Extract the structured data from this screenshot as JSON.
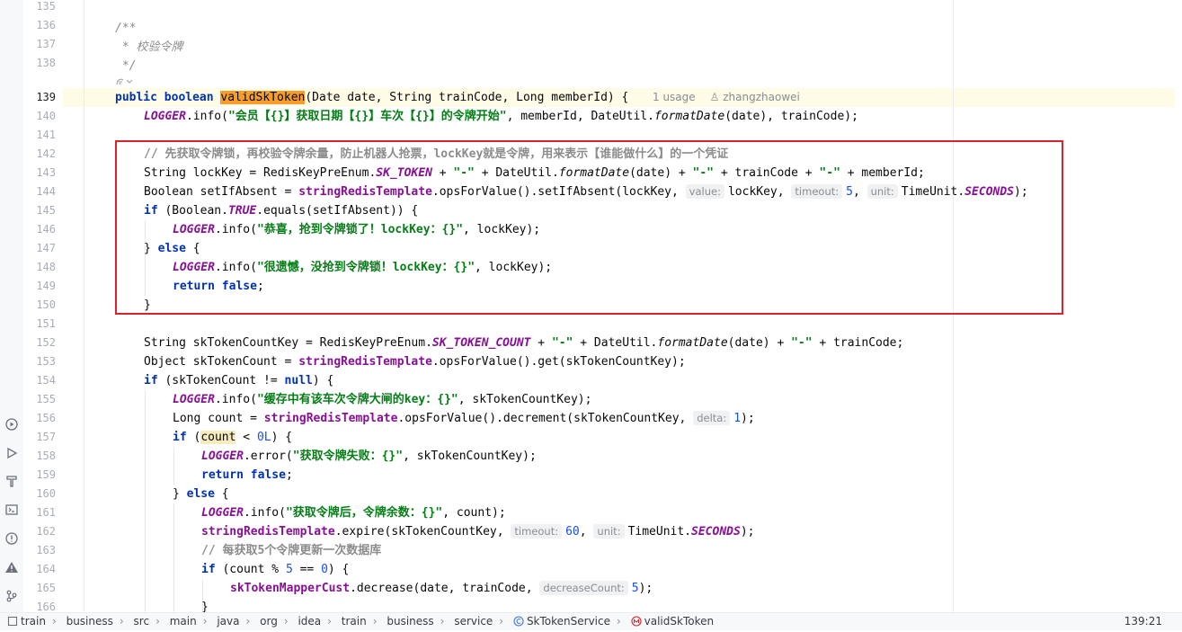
{
  "editor": {
    "usage_lens": "1 usage",
    "author_lens": "zhangzhaowei",
    "current_line": "139",
    "line_numbers": [
      "135",
      "136",
      "137",
      "138",
      "139",
      "140",
      "141",
      "142",
      "143",
      "144",
      "145",
      "146",
      "147",
      "148",
      "149",
      "150",
      "151",
      "152",
      "153",
      "154",
      "155",
      "156",
      "157",
      "158",
      "159",
      "160",
      "161",
      "162",
      "163",
      "164",
      "165",
      "166"
    ]
  },
  "code": {
    "l136": "/**",
    "l137": " * 校验令牌",
    "l138": " */",
    "l139_kw1": "public",
    "l139_kw2": "boolean",
    "l139_name": "validSkToken",
    "l139_params": "(Date date, String trainCode, Long memberId) {",
    "l140_logger": "LOGGER",
    "l140_call": ".info(",
    "l140_str": "\"会员【{}】获取日期【{}】车次【{}】的令牌开始\"",
    "l140_rest_a": ", memberId, DateUtil.",
    "l140_fmt": "formatDate",
    "l140_rest_b": "(date), trainCode);",
    "l142_comment": "// 先获取令牌锁，再校验令牌余量，防止机器人抢票，lockKey就是令牌，用来表示【谁能做什么】的一个凭证",
    "l143_a": "String lockKey = RedisKeyPreEnum.",
    "l143_const": "SK_TOKEN",
    "l143_b": " + ",
    "l143_dash": "\"-\"",
    "l143_c": " + DateUtil.",
    "l143_fmt": "formatDate",
    "l143_d": "(date) + ",
    "l143_e": " + trainCode + ",
    "l143_f": " + memberId;",
    "l144_a": "Boolean setIfAbsent = ",
    "l144_field": "stringRedisTemplate",
    "l144_b": ".opsForValue().setIfAbsent(lockKey, ",
    "l144_hint1": "value:",
    "l144_c": "lockKey, ",
    "l144_hint2": "timeout:",
    "l144_num": "5",
    "l144_d": ", ",
    "l144_hint3": "unit:",
    "l144_e": "TimeUnit.",
    "l144_const": "SECONDS",
    "l144_f": ");",
    "l145_kw": "if",
    "l145_a": " (Boolean.",
    "l145_const": "TRUE",
    "l145_b": ".equals(setIfAbsent)) {",
    "l146_logger": "LOGGER",
    "l146_call": ".info(",
    "l146_str": "\"恭喜，抢到令牌锁了！lockKey：{}\"",
    "l146_rest": ", lockKey);",
    "l147_a": "} ",
    "l147_kw": "else",
    "l147_b": " {",
    "l148_logger": "LOGGER",
    "l148_call": ".info(",
    "l148_str": "\"很遗憾，没抢到令牌锁！lockKey：{}\"",
    "l148_rest": ", lockKey);",
    "l149_kw1": "return",
    "l149_kw2": "false",
    "l149_semi": ";",
    "l150": "}",
    "l152_a": "String skTokenCountKey = RedisKeyPreEnum.",
    "l152_const": "SK_TOKEN_COUNT",
    "l152_b": " + ",
    "l152_dash": "\"-\"",
    "l152_c": " + DateUtil.",
    "l152_fmt": "formatDate",
    "l152_d": "(date) + ",
    "l152_e": " + trainCode;",
    "l153_a": "Object skTokenCount = ",
    "l153_field": "stringRedisTemplate",
    "l153_b": ".opsForValue().get(skTokenCountKey);",
    "l154_kw": "if",
    "l154_a": " (skTokenCount != ",
    "l154_null": "null",
    "l154_b": ") {",
    "l155_logger": "LOGGER",
    "l155_call": ".info(",
    "l155_str": "\"缓存中有该车次令牌大闸的key：{}\"",
    "l155_rest": ", skTokenCountKey);",
    "l156_a": "Long count = ",
    "l156_field": "stringRedisTemplate",
    "l156_b": ".opsForValue().decrement(skTokenCountKey, ",
    "l156_hint": "delta:",
    "l156_num": "1",
    "l156_c": ");",
    "l157_kw": "if",
    "l157_a": " (",
    "l157_var": "count",
    "l157_b": " < ",
    "l157_num": "0L",
    "l157_c": ") {",
    "l158_logger": "LOGGER",
    "l158_call": ".error(",
    "l158_str": "\"获取令牌失败：{}\"",
    "l158_rest": ", skTokenCountKey);",
    "l159_kw1": "return",
    "l159_kw2": "false",
    "l159_semi": ";",
    "l160_a": "} ",
    "l160_kw": "else",
    "l160_b": " {",
    "l161_logger": "LOGGER",
    "l161_call": ".info(",
    "l161_str": "\"获取令牌后，令牌余数：{}\"",
    "l161_rest": ", count);",
    "l162_field": "stringRedisTemplate",
    "l162_a": ".expire(skTokenCountKey, ",
    "l162_hint1": "timeout:",
    "l162_num": "60",
    "l162_b": ", ",
    "l162_hint2": "unit:",
    "l162_c": "TimeUnit.",
    "l162_const": "SECONDS",
    "l162_d": ");",
    "l163_comment": "// 每获取5个令牌更新一次数据库",
    "l164_kw": "if",
    "l164_a": " (count % ",
    "l164_num1": "5",
    "l164_b": " == ",
    "l164_num2": "0",
    "l164_c": ") {",
    "l165_field": "skTokenMapperCust",
    "l165_a": ".decrease(date, trainCode, ",
    "l165_hint": "decreaseCount:",
    "l165_num": "5",
    "l165_b": ");",
    "l166": "}"
  },
  "statusbar": {
    "breadcrumbs": [
      "train",
      "business",
      "src",
      "main",
      "java",
      "org",
      "idea",
      "train",
      "business",
      "service",
      "SkTokenService",
      "validSkToken"
    ],
    "cursor_position": "139:21"
  },
  "colors": {
    "keyword": "#0033b3",
    "string": "#067d17",
    "field": "#871094",
    "number": "#1750eb",
    "comment": "#8c8c8c",
    "method_highlight": "#f79d2c",
    "annotation_box": "#d9232f"
  },
  "icons": {
    "left_strip": [
      "services-icon",
      "run-icon",
      "build-icon",
      "terminal-icon",
      "problems-icon",
      "warning-icon",
      "git-icon"
    ],
    "class_icon": "class-icon",
    "method_icon": "method-icon",
    "module_icon": "module-icon"
  }
}
